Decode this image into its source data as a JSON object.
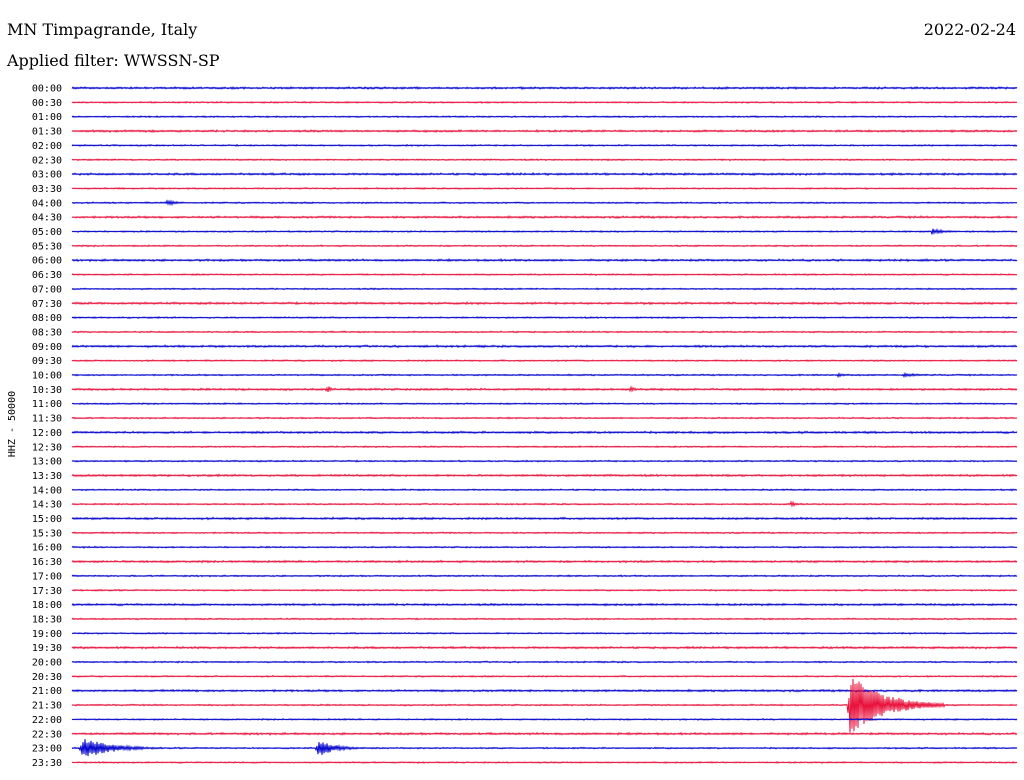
{
  "header": {
    "station": "MN Timpagrande, Italy",
    "date": "2022-02-24",
    "filter": "Applied filter: WWSSN-SP"
  },
  "colors": {
    "blue": "#0000cc",
    "red": "#e8103a"
  },
  "chart_data": {
    "type": "line",
    "title": "MN Timpagrande, Italy",
    "subtitle": "Applied filter: WWSSN-SP",
    "ylabel": "HHZ - 50000",
    "categories": [
      "00:00",
      "00:30",
      "01:00",
      "01:30",
      "02:00",
      "02:30",
      "03:00",
      "03:30",
      "04:00",
      "04:30",
      "05:00",
      "05:30",
      "06:00",
      "06:30",
      "07:00",
      "07:30",
      "08:00",
      "08:30",
      "09:00",
      "09:30",
      "10:00",
      "10:30",
      "11:00",
      "11:30",
      "12:00",
      "12:30",
      "13:00",
      "13:30",
      "14:00",
      "14:30",
      "15:00",
      "15:30",
      "16:00",
      "16:30",
      "17:00",
      "17:30",
      "18:00",
      "18:30",
      "19:00",
      "19:30",
      "20:00",
      "20:30",
      "21:00",
      "21:30",
      "22:00",
      "22:30",
      "23:00",
      "23:30"
    ],
    "trace_colors": [
      "blue",
      "red"
    ],
    "events": [
      {
        "row": 8,
        "x": 0.1,
        "amp": 3,
        "dur": 0.03
      },
      {
        "row": 10,
        "x": 0.91,
        "amp": 3,
        "dur": 0.04
      },
      {
        "row": 20,
        "x": 0.81,
        "amp": 2,
        "dur": 0.02
      },
      {
        "row": 20,
        "x": 0.88,
        "amp": 2,
        "dur": 0.05
      },
      {
        "row": 21,
        "x": 0.27,
        "amp": 5,
        "dur": 0.01
      },
      {
        "row": 21,
        "x": 0.59,
        "amp": 3,
        "dur": 0.02
      },
      {
        "row": 29,
        "x": 0.76,
        "amp": 3,
        "dur": 0.02
      },
      {
        "row": 43,
        "x": 0.823,
        "amp": 32,
        "dur": 0.1
      },
      {
        "row": 46,
        "x": 0.01,
        "amp": 12,
        "dur": 0.08
      },
      {
        "row": 46,
        "x": 0.26,
        "amp": 9,
        "dur": 0.05
      }
    ]
  }
}
